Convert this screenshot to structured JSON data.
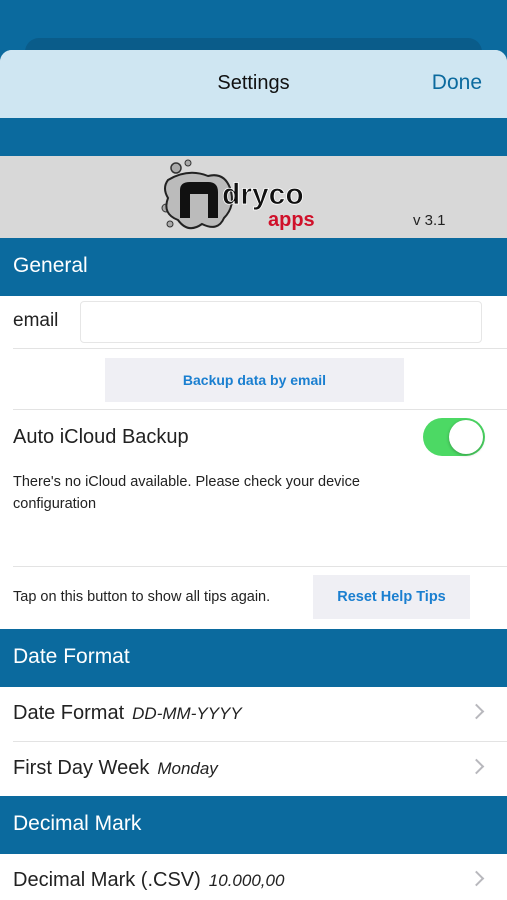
{
  "nav": {
    "title": "Settings",
    "done_label": "Done"
  },
  "brand": {
    "logo_text": "ndryco apps",
    "version": "v 3.1"
  },
  "general": {
    "header": "General",
    "email_label": "email",
    "email_value": "",
    "backup_button": "Backup data by email",
    "icloud_label": "Auto iCloud Backup",
    "icloud_enabled": true,
    "icloud_message": "There's no iCloud available. Please check your device configuration",
    "tips_text": "Tap on this button to show all tips again.",
    "reset_button": "Reset Help Tips"
  },
  "date_format": {
    "header": "Date Format",
    "rows": [
      {
        "label": "Date Format",
        "value": "DD-MM-YYYY"
      },
      {
        "label": "First Day Week",
        "value": "Monday"
      }
    ]
  },
  "decimal_mark": {
    "header": "Decimal Mark",
    "rows": [
      {
        "label": "Decimal Mark (.CSV)",
        "value": "10.000,00"
      }
    ]
  },
  "colors": {
    "accent": "#0b6a9e",
    "toggle_on": "#4cd964",
    "link": "#1a7fd0"
  }
}
